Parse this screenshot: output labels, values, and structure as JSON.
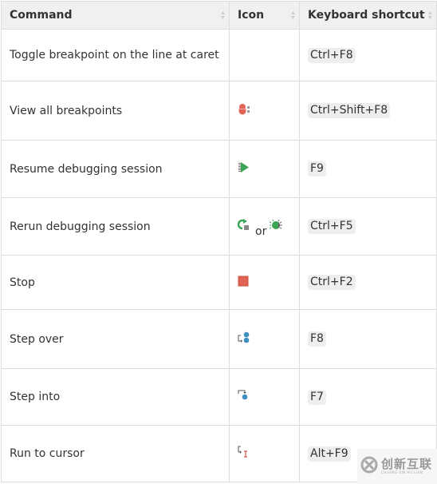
{
  "table": {
    "headers": [
      "Command",
      "Icon",
      "Keyboard shortcut"
    ],
    "rows": [
      {
        "command": "Toggle breakpoint on the line at caret",
        "icons": [],
        "shortcut": "Ctrl+F8"
      },
      {
        "command": "View all breakpoints",
        "icons": [
          "view-breakpoints-icon"
        ],
        "shortcut": "Ctrl+Shift+F8"
      },
      {
        "command": "Resume debugging session",
        "icons": [
          "resume-icon"
        ],
        "shortcut": "F9"
      },
      {
        "command": "Rerun debugging session",
        "icons": [
          "rerun-icon",
          "debug-bug-icon"
        ],
        "icon_separator": "or",
        "shortcut": "Ctrl+F5"
      },
      {
        "command": "Stop",
        "icons": [
          "stop-icon"
        ],
        "shortcut": "Ctrl+F2"
      },
      {
        "command": "Step over",
        "icons": [
          "step-over-icon"
        ],
        "shortcut": "F8"
      },
      {
        "command": "Step into",
        "icons": [
          "step-into-icon"
        ],
        "shortcut": "F7"
      },
      {
        "command": "Run to cursor",
        "icons": [
          "run-to-cursor-icon"
        ],
        "shortcut": "Alt+F9"
      }
    ]
  },
  "colors": {
    "breakpoint_red": "#e06355",
    "resume_green": "#3aa655",
    "step_blue": "#3d8fbf",
    "stop_red": "#e06355",
    "header_bg": "#f0f0f0",
    "border": "#dddddd",
    "kbd_bg": "#eeeeee"
  },
  "watermark": {
    "text": "创新互联",
    "subtext": "CHUANG XIN HU LIAN"
  }
}
